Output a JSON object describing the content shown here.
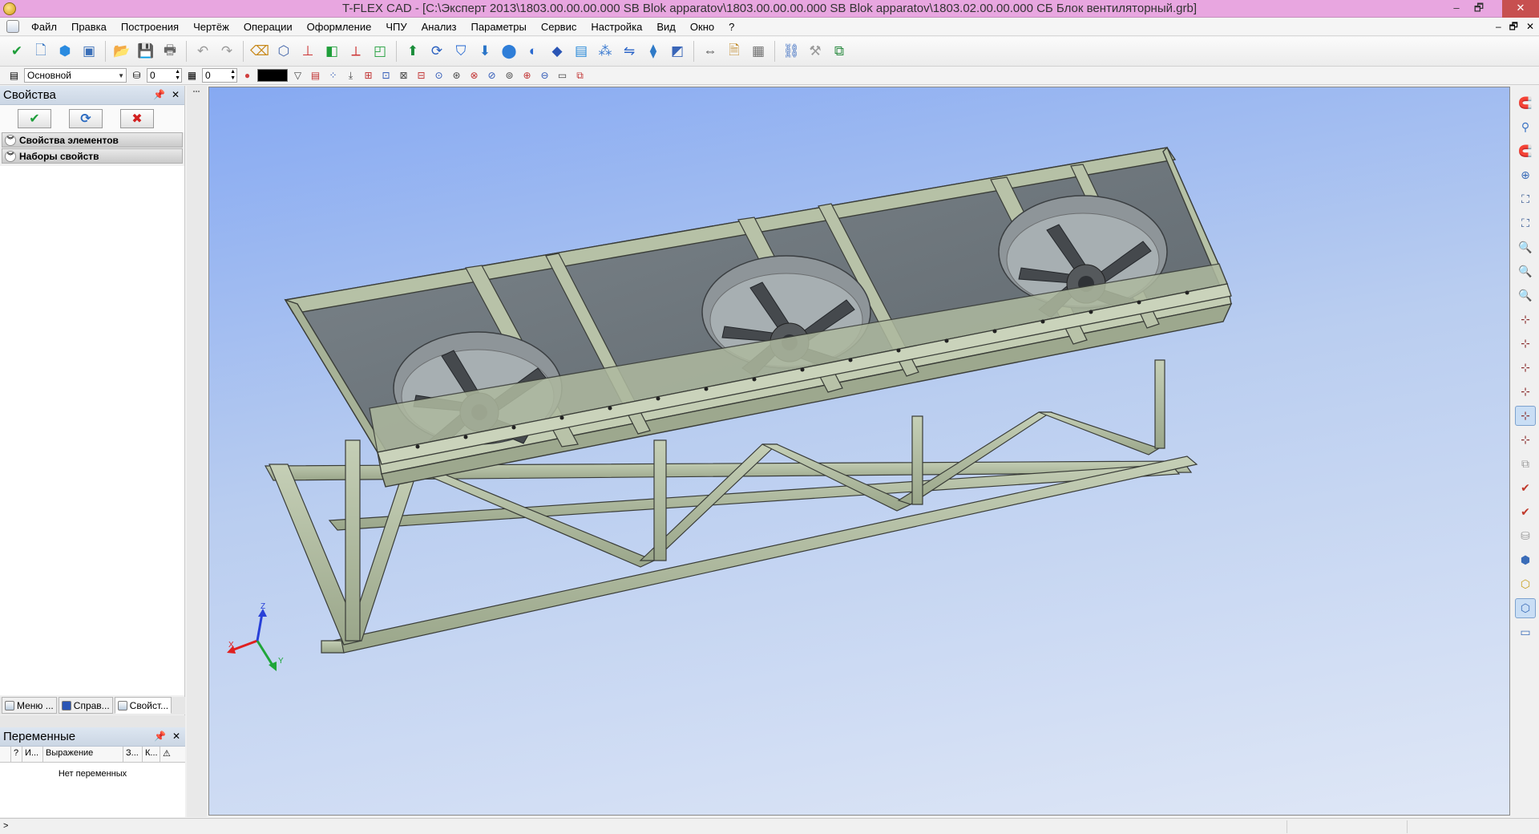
{
  "window": {
    "title": "T-FLEX CAD - [C:\\Эксперт 2013\\1803.00.00.00.000 SB Blok apparatov\\1803.00.00.00.000 SB Blok apparatov\\1803.02.00.00.000 СБ Блок вентиляторный.grb]",
    "app_icon": "tflex-logo-icon",
    "controls": [
      "minimize-icon",
      "maximize-icon",
      "close-icon"
    ]
  },
  "menu": {
    "items": [
      "Файл",
      "Правка",
      "Построения",
      "Чертёж",
      "Операции",
      "Оформление",
      "ЧПУ",
      "Анализ",
      "Параметры",
      "Сервис",
      "Настройка",
      "Вид",
      "Окно",
      "?"
    ],
    "mdi_controls": [
      "–",
      "🗗",
      "✕"
    ]
  },
  "toolbar_main": {
    "buttons": [
      {
        "name": "checkmark-icon",
        "glyph": "✔",
        "color": "#1e9e3a"
      },
      {
        "name": "new-file-icon",
        "glyph": "🗋",
        "color": "#3a78c2"
      },
      {
        "name": "3d-model-icon",
        "glyph": "⬢",
        "color": "#2a8be0"
      },
      {
        "name": "window-icon",
        "glyph": "▣",
        "color": "#3a6fb8"
      },
      {
        "name": "open-folder-icon",
        "glyph": "📂",
        "color": "#d2a03a"
      },
      {
        "name": "save-icon",
        "glyph": "💾",
        "color": "#2d5fae"
      },
      {
        "name": "print-icon",
        "glyph": "🖶",
        "color": "#666666"
      },
      {
        "name": "undo-icon",
        "glyph": "↶",
        "color": "#9a9a9a"
      },
      {
        "name": "redo-icon",
        "glyph": "↷",
        "color": "#9a9a9a"
      },
      {
        "name": "eraser-icon",
        "glyph": "⌫",
        "color": "#c88a1d"
      },
      {
        "name": "view-cube-icon",
        "glyph": "⬡",
        "color": "#4466aa"
      },
      {
        "name": "axis-icon",
        "glyph": "⊥",
        "color": "#cc3333"
      },
      {
        "name": "profile-icon",
        "glyph": "◧",
        "color": "#1f9e3a"
      },
      {
        "name": "coordinate-system-icon",
        "glyph": "⟂",
        "color": "#cc3333"
      },
      {
        "name": "workplane-icon",
        "glyph": "◰",
        "color": "#1f9e3a"
      },
      {
        "name": "extrusion-icon",
        "glyph": "⬆",
        "color": "#1a8d3a"
      },
      {
        "name": "rotation-icon",
        "glyph": "⟳",
        "color": "#2a60c0"
      },
      {
        "name": "loft-icon",
        "glyph": "⛉",
        "color": "#1f64d0"
      },
      {
        "name": "sweep-icon",
        "glyph": "⬇",
        "color": "#2a75c8"
      },
      {
        "name": "boolean-icon",
        "glyph": "⬤",
        "color": "#2f7ed8"
      },
      {
        "name": "smooth-icon",
        "glyph": "◐",
        "color": "#2b6ad0"
      },
      {
        "name": "chamfer-icon",
        "glyph": "◆",
        "color": "#2a55b5"
      },
      {
        "name": "shell-icon",
        "glyph": "▤",
        "color": "#2a8ad8"
      },
      {
        "name": "array-icon",
        "glyph": "⁂",
        "color": "#3a7ad0"
      },
      {
        "name": "mirror-icon",
        "glyph": "⇋",
        "color": "#2c65c8"
      },
      {
        "name": "sheet-metal-icon",
        "glyph": "⧫",
        "color": "#2f7ac7"
      },
      {
        "name": "section-icon",
        "glyph": "◩",
        "color": "#3a66b8"
      },
      {
        "name": "measure-icon",
        "glyph": "⇔",
        "color": "#444444"
      },
      {
        "name": "report-icon",
        "glyph": "🗎",
        "color": "#c08a2a"
      },
      {
        "name": "calculator-icon",
        "glyph": "▦",
        "color": "#707070"
      },
      {
        "name": "link-icon",
        "glyph": "⛓",
        "color": "#3b6cc0"
      },
      {
        "name": "tools-icon",
        "glyph": "⚒",
        "color": "#9a9a9a"
      },
      {
        "name": "window-arrange-icon",
        "glyph": "⧉",
        "color": "#2a8a40"
      }
    ]
  },
  "toolbar_props": {
    "layer_value": "Основной",
    "level1_value": "0",
    "level2_value": "0",
    "color_value": "#000000",
    "buttons": [
      "filter-icon",
      "select-icon",
      "node-icon",
      "snap-icon",
      "snap-grid-icon",
      "snap-line-icon",
      "snap-end-icon",
      "snap-mid-icon",
      "snap-center-icon",
      "snap-tangent-icon",
      "snap-intersection-icon",
      "snap-normal-icon",
      "snap-point-icon",
      "snap-vertex-icon",
      "snap-quadrant-icon",
      "snap-3d-icon",
      "snap-custom-icon"
    ]
  },
  "properties_panel": {
    "title": "Свойства",
    "ok_glyph": "✔",
    "refresh_glyph": "⟳",
    "cancel_glyph": "✖",
    "sections": [
      "Свойства элементов",
      "Наборы свойств"
    ],
    "tabs": [
      "Меню ...",
      "Справ...",
      "Свойст..."
    ],
    "active_tab": 2
  },
  "variables_panel": {
    "title": "Переменные",
    "columns": [
      "",
      "?",
      "И...",
      "Выражение",
      "З...",
      "К...",
      "⚠"
    ],
    "empty_text": "Нет переменных"
  },
  "viewport": {
    "axes": {
      "x": "X",
      "y": "Y",
      "z": "Z"
    },
    "model": "Fan cooling block assembly with three fans",
    "frame_color": "#b9c4ab",
    "dark_steel": "#4a4e52"
  },
  "right_toolbar": {
    "buttons": [
      {
        "name": "magnet-icon",
        "glyph": "🧲",
        "color": "#c0392b"
      },
      {
        "name": "magnet-off-icon",
        "glyph": "⚲",
        "color": "#3b73c4"
      },
      {
        "name": "magnet-on-icon",
        "glyph": "🧲",
        "color": "#1f8a3a"
      },
      {
        "name": "zoom-window-icon",
        "glyph": "⊕",
        "color": "#3a6cb8"
      },
      {
        "name": "zoom-all-icon",
        "glyph": "⛶",
        "color": "#2a4f8a"
      },
      {
        "name": "fit-page-icon",
        "glyph": "⛶",
        "color": "#2a4f8a"
      },
      {
        "name": "zoom-in-icon",
        "glyph": "🔍",
        "color": "#3a6cb8"
      },
      {
        "name": "zoom-out-icon",
        "glyph": "🔍",
        "color": "#3a6cb8"
      },
      {
        "name": "zoom-previous-icon",
        "glyph": "🔍",
        "color": "#3a6cb8"
      },
      {
        "name": "snap-node-icon",
        "glyph": "⊹",
        "color": "#8a2d2d"
      },
      {
        "name": "snap-point-icon",
        "glyph": "⊹",
        "color": "#8a2d2d"
      },
      {
        "name": "snap-edge-icon",
        "glyph": "⊹",
        "color": "#8a2d2d"
      },
      {
        "name": "snap-face-icon",
        "glyph": "⊹",
        "color": "#8a2d2d"
      },
      {
        "name": "snap-active-icon",
        "glyph": "⊹",
        "color": "#8a2d2d"
      },
      {
        "name": "snap-vertex-icon",
        "glyph": "⊹",
        "color": "#8a2d2d"
      },
      {
        "name": "copy-icon",
        "glyph": "⧉",
        "color": "#9a9a9a"
      },
      {
        "name": "check-body-icon",
        "glyph": "✔",
        "color": "#c0392b"
      },
      {
        "name": "check-face-icon",
        "glyph": "✔",
        "color": "#c0392b"
      },
      {
        "name": "layers-icon",
        "glyph": "⛁",
        "color": "#9a9a9a"
      },
      {
        "name": "shade-icon",
        "glyph": "⬢",
        "color": "#3a6cb8"
      },
      {
        "name": "shade-wire-icon",
        "glyph": "⬡",
        "color": "#c8a020"
      },
      {
        "name": "wireframe-icon",
        "glyph": "⬡",
        "color": "#3a6cb8"
      },
      {
        "name": "frame-icon",
        "glyph": "▭",
        "color": "#3a6cb8"
      }
    ]
  },
  "statusbar": {
    "prompt": ">"
  }
}
